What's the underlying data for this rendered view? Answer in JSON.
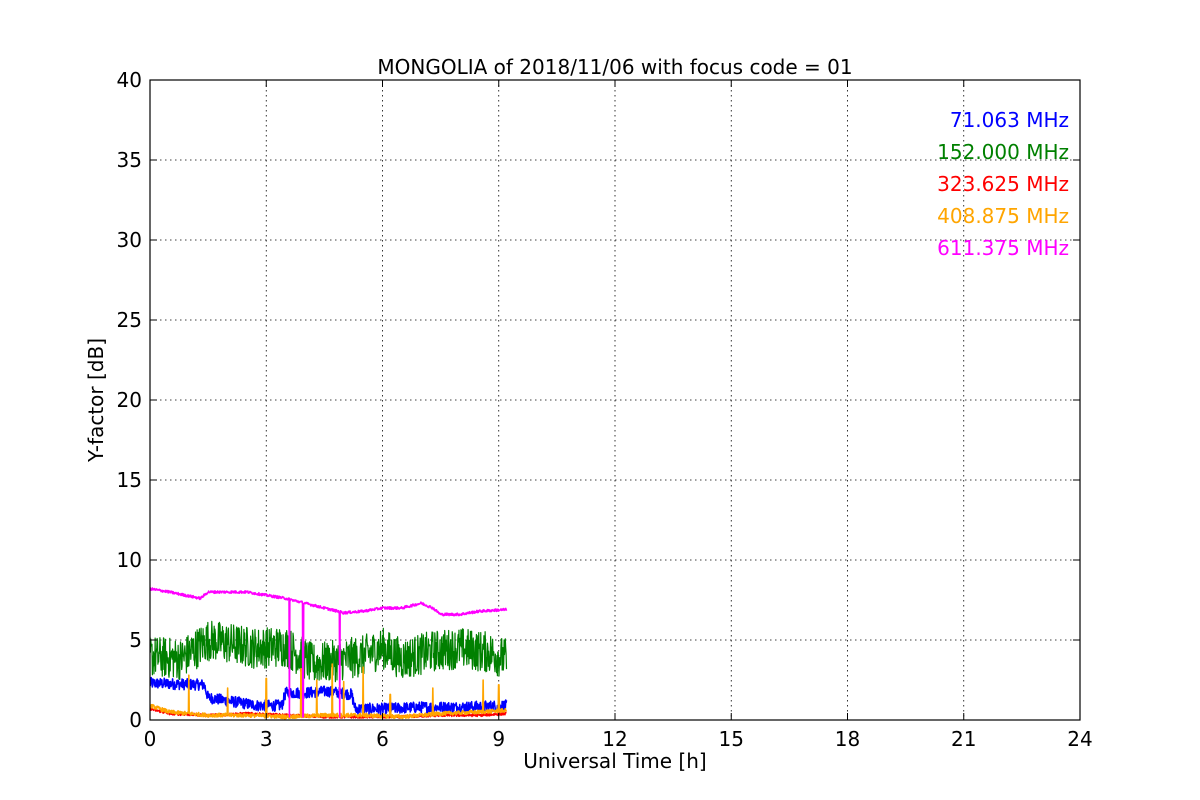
{
  "chart_data": {
    "type": "line",
    "title": "MONGOLIA of 2018/11/06 with focus code = 01",
    "xlabel": "Universal Time [h]",
    "ylabel": "Y-factor [dB]",
    "xlim": [
      0,
      24
    ],
    "ylim": [
      0,
      40
    ],
    "xticks": [
      "0",
      "3",
      "6",
      "9",
      "12",
      "15",
      "18",
      "21",
      "24"
    ],
    "yticks": [
      "0",
      "5",
      "10",
      "15",
      "20",
      "25",
      "30",
      "35",
      "40"
    ],
    "grid": true,
    "legend_position": "top-right",
    "series": [
      {
        "name": "71.063 MHz",
        "color": "#0000ff",
        "noise": 0.35,
        "x": [
          0,
          1.4,
          1.5,
          2.0,
          2.8,
          3.4,
          3.5,
          4.0,
          4.6,
          5.2,
          5.3,
          6.0,
          7.0,
          8.0,
          9.2
        ],
        "y": [
          2.3,
          2.2,
          1.4,
          1.2,
          0.9,
          0.9,
          1.7,
          1.7,
          1.8,
          1.6,
          0.7,
          0.7,
          0.8,
          0.8,
          0.9
        ]
      },
      {
        "name": "152.000 MHz",
        "color": "#008000",
        "noise": 1.3,
        "x": [
          0,
          0.8,
          1.5,
          2.0,
          2.7,
          3.5,
          4.2,
          4.8,
          5.5,
          6.0,
          6.5,
          7.3,
          8.0,
          8.8,
          9.2
        ],
        "y": [
          4.0,
          3.8,
          5.0,
          4.8,
          4.5,
          4.6,
          3.5,
          3.7,
          4.0,
          4.5,
          3.8,
          4.3,
          4.5,
          4.2,
          3.8
        ]
      },
      {
        "name": "323.625 MHz",
        "color": "#ff0000",
        "noise": 0.08,
        "x": [
          0,
          0.5,
          1.5,
          2.5,
          3.5,
          4.5,
          5.5,
          6.5,
          7.5,
          8.5,
          9.2
        ],
        "y": [
          0.7,
          0.4,
          0.3,
          0.4,
          0.3,
          0.2,
          0.2,
          0.2,
          0.3,
          0.3,
          0.4
        ]
      },
      {
        "name": "408.875 MHz",
        "color": "#ffa500",
        "noise": 0.12,
        "x": [
          0,
          0.5,
          1.5,
          2.5,
          3.5,
          4.5,
          5.5,
          6.5,
          7.5,
          8.5,
          9.2
        ],
        "y": [
          0.9,
          0.5,
          0.3,
          0.3,
          0.2,
          0.3,
          0.3,
          0.2,
          0.4,
          0.5,
          0.6
        ],
        "spikes": [
          [
            1.0,
            2.8
          ],
          [
            2.0,
            2.0
          ],
          [
            3.0,
            2.6
          ],
          [
            3.9,
            3.2
          ],
          [
            4.3,
            2.5
          ],
          [
            4.7,
            3.5
          ],
          [
            5.0,
            2.4
          ],
          [
            5.5,
            3.3
          ],
          [
            6.2,
            1.6
          ],
          [
            7.3,
            2.0
          ],
          [
            8.6,
            2.5
          ],
          [
            9.0,
            2.2
          ]
        ]
      },
      {
        "name": "611.375 MHz",
        "color": "#ff00ff",
        "noise": 0.08,
        "x": [
          0,
          0.5,
          1.3,
          1.5,
          2.5,
          3.0,
          3.5,
          4.0,
          4.5,
          5.0,
          5.5,
          6.0,
          6.5,
          7.0,
          7.3,
          7.5,
          8.0,
          8.5,
          9.2
        ],
        "y": [
          8.2,
          8.0,
          7.6,
          8.0,
          8.0,
          7.8,
          7.6,
          7.3,
          7.0,
          6.7,
          6.8,
          7.0,
          7.0,
          7.3,
          7.0,
          6.6,
          6.6,
          6.8,
          6.9
        ],
        "spikes": [
          [
            3.6,
            0.2
          ],
          [
            3.95,
            0.2
          ],
          [
            4.9,
            0.2
          ]
        ]
      }
    ]
  }
}
